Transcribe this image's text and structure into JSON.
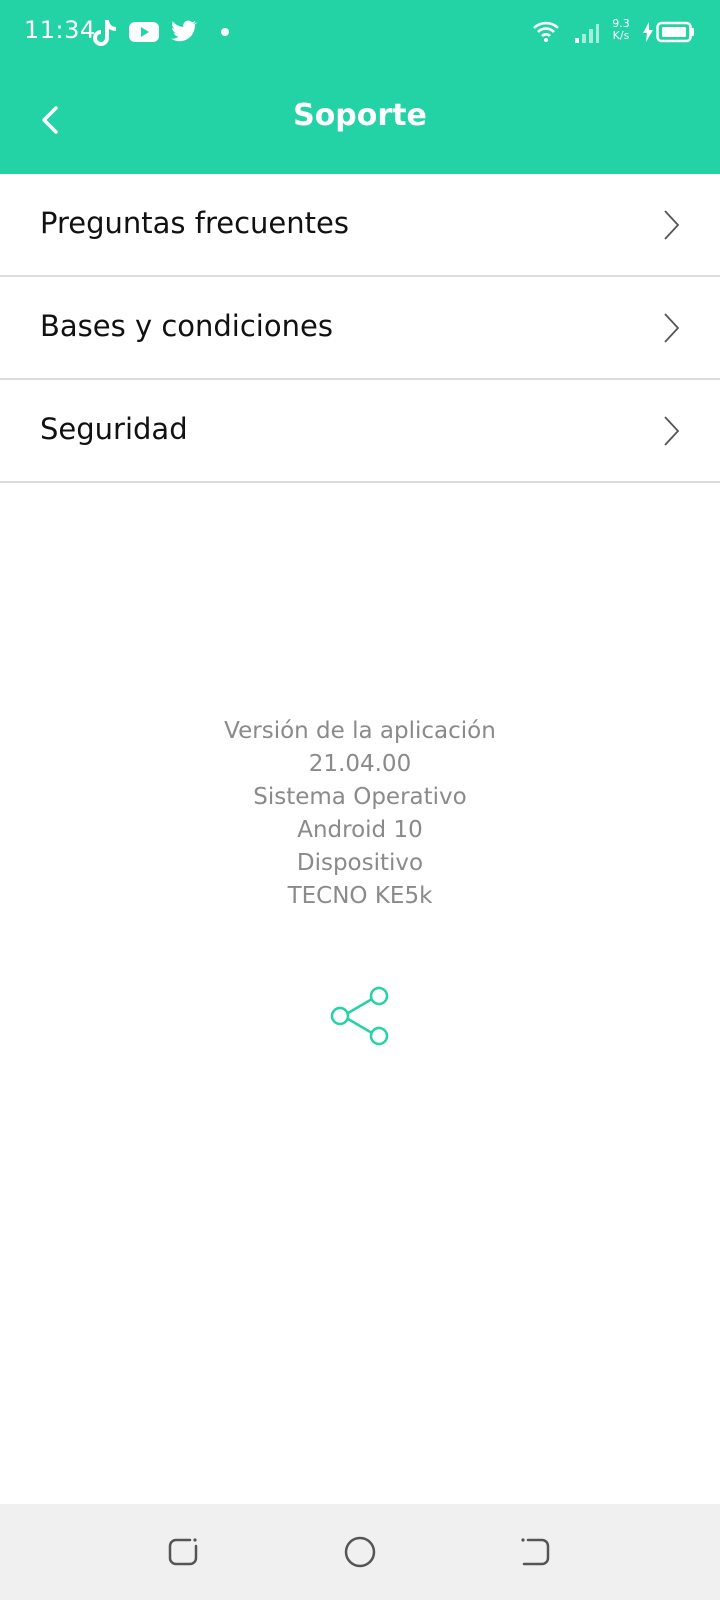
{
  "status_bar": {
    "time": "11:34",
    "net_speed_value": "9.3",
    "net_speed_unit": "K/s",
    "icons": [
      "tiktok-icon",
      "youtube-icon",
      "twitter-icon",
      "notification-dot",
      "wifi-icon",
      "signal-icon",
      "charging-icon",
      "battery-icon"
    ]
  },
  "app_bar": {
    "title": "Soporte",
    "back_icon": "back-arrow-icon",
    "background": "#24d3a5"
  },
  "menu": {
    "items": [
      {
        "label": "Preguntas frecuentes",
        "icon": "chevron-right-icon"
      },
      {
        "label": "Bases y condiciones",
        "icon": "chevron-right-icon"
      },
      {
        "label": "Seguridad",
        "icon": "chevron-right-icon"
      }
    ]
  },
  "app_info": {
    "version_label": "Versión de la aplicación",
    "version_value": "21.04.00",
    "os_label": "Sistema Operativo",
    "os_value": "Android 10",
    "device_label": "Dispositivo",
    "device_value": "TECNO KE5k"
  },
  "share": {
    "icon": "share-icon",
    "color": "#24d3a5"
  },
  "nav_bar": {
    "buttons": [
      "recent-apps-icon",
      "home-icon",
      "back-icon"
    ]
  }
}
